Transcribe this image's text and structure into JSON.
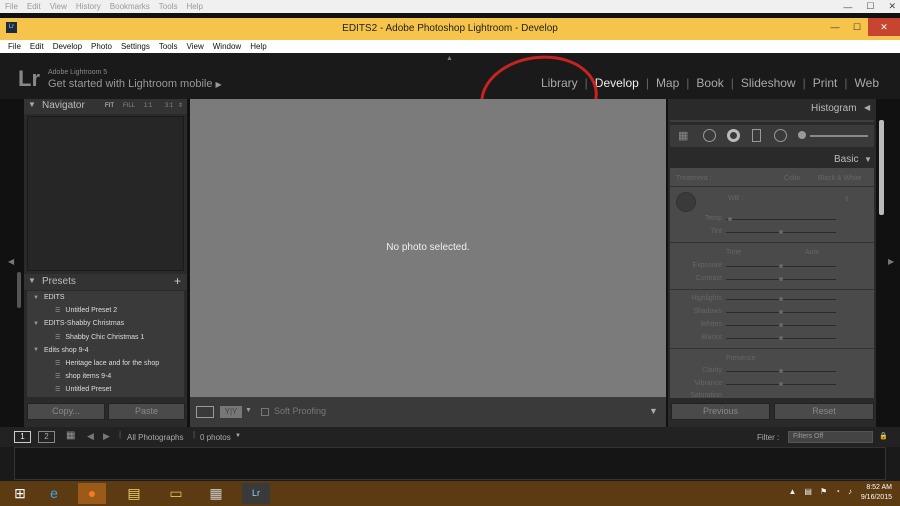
{
  "firefox_menu": [
    "File",
    "Edit",
    "View",
    "History",
    "Bookmarks",
    "Tools",
    "Help"
  ],
  "window_title": "EDITS2 - Adobe Photoshop Lightroom - Develop",
  "app_menu": [
    "File",
    "Edit",
    "Develop",
    "Photo",
    "Settings",
    "Tools",
    "View",
    "Window",
    "Help"
  ],
  "identity": {
    "logo": "Lr",
    "version": "Adobe Lightroom 5",
    "tagline": "Get started with Lightroom mobile"
  },
  "modules": [
    "Library",
    "Develop",
    "Map",
    "Book",
    "Slideshow",
    "Print",
    "Web"
  ],
  "active_module": "Develop",
  "navigator": {
    "title": "Navigator",
    "zoom": [
      "FIT",
      "FILL",
      "1:1",
      "3:1"
    ]
  },
  "presets": {
    "title": "Presets",
    "items": [
      {
        "type": "folder",
        "label": "EDITS"
      },
      {
        "type": "preset",
        "label": "Untitled Preset 2"
      },
      {
        "type": "folder",
        "label": "EDITS-Shabby Christmas"
      },
      {
        "type": "preset",
        "label": "Shabby Chic Christmas 1"
      },
      {
        "type": "folder",
        "label": "Edits shop 9-4"
      },
      {
        "type": "preset",
        "label": "Heritage lace and for the shop"
      },
      {
        "type": "preset",
        "label": "shop items 9-4"
      },
      {
        "type": "preset",
        "label": "Untitled Preset"
      }
    ]
  },
  "left_buttons": {
    "copy": "Copy...",
    "paste": "Paste"
  },
  "center": {
    "message": "No photo selected.",
    "soft_proofing": "Soft Proofing"
  },
  "right": {
    "histogram": "Histogram",
    "basic": "Basic",
    "treatment_label": "Treatment :",
    "color": "Color",
    "bw": "Black & White",
    "wb": "WB :",
    "tone": "Tone",
    "auto": "Auto",
    "presence": "Presence",
    "sliders": [
      "Temp",
      "Tint",
      "Exposure",
      "Contrast",
      "Highlights",
      "Shadows",
      "Whites",
      "Blacks",
      "Clarity",
      "Vibrance",
      "Saturation"
    ],
    "previous": "Previous",
    "reset": "Reset"
  },
  "filmbar": {
    "page1": "1",
    "page2": "2",
    "source": "All Photographs",
    "count": "0 photos",
    "filter_label": "Filter :",
    "filter_value": "Filters Off"
  },
  "clock": {
    "time": "8:52 AM",
    "date": "9/16/2015"
  },
  "accent_color": "#f6c34b",
  "annotation_color": "#c8241f"
}
